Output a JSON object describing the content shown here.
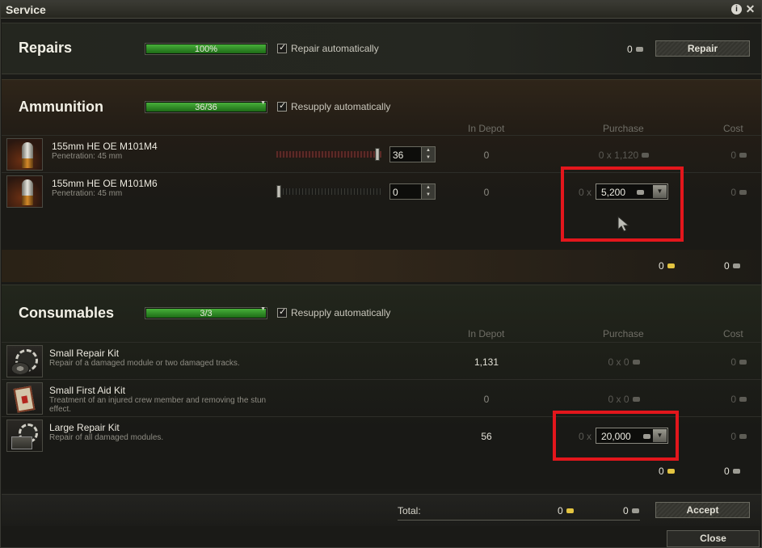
{
  "window": {
    "title": "Service",
    "info_icon": "i",
    "close_icon": "✕"
  },
  "columns": {
    "in_depot": "In Depot",
    "purchase": "Purchase",
    "cost": "Cost"
  },
  "repairs": {
    "title": "Repairs",
    "progress_text": "100%",
    "progress_value": 1.0,
    "auto_label": "Repair automatically",
    "auto_checked": true,
    "cost": "0",
    "button_label": "Repair"
  },
  "ammunition": {
    "title": "Ammunition",
    "progress_text": "36/36",
    "progress_value": 1.0,
    "auto_label": "Resupply automatically",
    "auto_checked": true,
    "items": [
      {
        "name": "155mm HE OE M101M4",
        "desc": "Penetration: 45 mm",
        "count": "36",
        "slider_value": 1.0,
        "depot": "0",
        "purchase_qty": "0 x",
        "purchase_price": "1,120",
        "cost": "0"
      },
      {
        "name": "155mm HE OE M101M6",
        "desc": "Penetration: 45 mm",
        "count": "0",
        "slider_value": 0.0,
        "depot": "0",
        "purchase_qty": "0 x",
        "purchase_price": "5,200",
        "cost": "0"
      }
    ],
    "subtotal_gold": "0",
    "subtotal_credits": "0"
  },
  "consumables": {
    "title": "Consumables",
    "progress_text": "3/3",
    "progress_value": 1.0,
    "auto_label": "Resupply automatically",
    "auto_checked": true,
    "items": [
      {
        "name": "Small Repair Kit",
        "desc": "Repair of a damaged module or two damaged tracks.",
        "depot": "1,131",
        "purchase_text": "0 x 0",
        "cost": "0"
      },
      {
        "name": "Small First Aid Kit",
        "desc": "Treatment of an injured crew member and removing the stun effect.",
        "depot": "0",
        "purchase_text": "0 x 0",
        "cost": "0"
      },
      {
        "name": "Large Repair Kit",
        "desc": "Repair of all damaged modules.",
        "depot": "56",
        "purchase_qty": "0 x",
        "purchase_price": "20,000",
        "cost": "0"
      }
    ],
    "subtotal_gold": "0",
    "subtotal_credits": "0"
  },
  "footer": {
    "total_label": "Total:",
    "total_gold": "0",
    "total_credits": "0",
    "accept_label": "Accept",
    "close_label": "Close"
  },
  "colors": {
    "highlight": "#e3161c",
    "progress_green": "#3aa02e",
    "gold": "#e3c441"
  }
}
